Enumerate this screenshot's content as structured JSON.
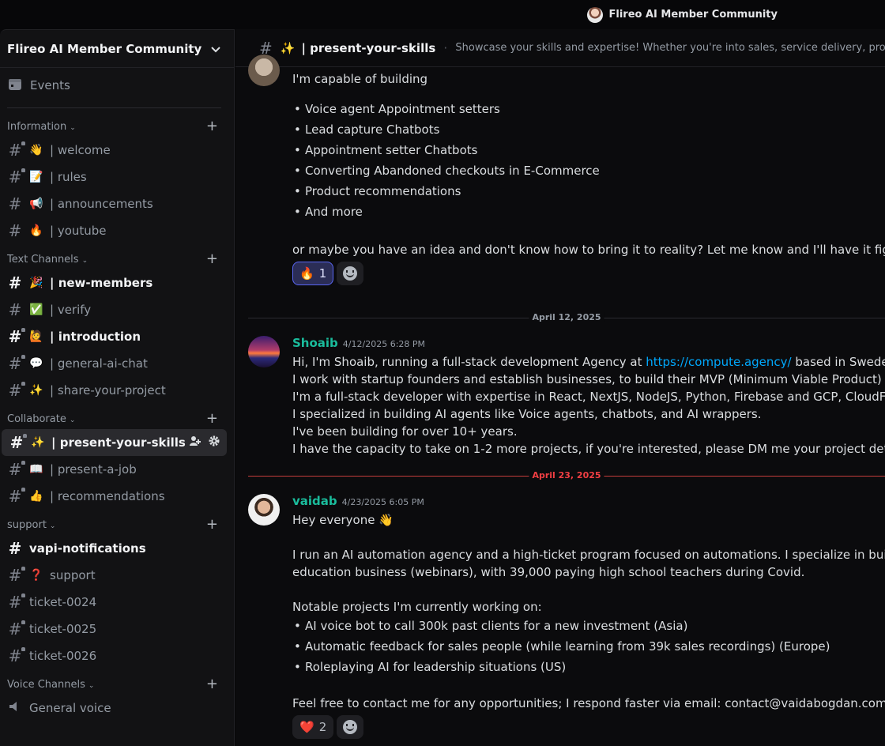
{
  "topbar": {
    "server_title": "Flireo AI Member Community"
  },
  "sidebar": {
    "server_name": "Flireo AI Member Community",
    "events_label": "Events",
    "categories": [
      {
        "name": "Information",
        "channels": [
          {
            "emoji": "👋",
            "label": "| welcome"
          },
          {
            "emoji": "📝",
            "label": "| rules"
          },
          {
            "emoji": "📢",
            "label": "| announcements"
          },
          {
            "emoji": "🔥",
            "label": "| youtube"
          }
        ]
      },
      {
        "name": "Text Channels",
        "channels": [
          {
            "emoji": "🎉",
            "label": "| new-members"
          },
          {
            "emoji": "✅",
            "label": "| verify"
          },
          {
            "emoji": "🙋",
            "label": "| introduction"
          },
          {
            "emoji": "💬",
            "label": "| general-ai-chat"
          },
          {
            "emoji": "✨",
            "label": "| share-your-project"
          }
        ]
      },
      {
        "name": "Collaborate",
        "channels": [
          {
            "emoji": "✨",
            "label": "| present-your-skills"
          },
          {
            "emoji": "📖",
            "label": "| present-a-job"
          },
          {
            "emoji": "👍",
            "label": "| recommendations"
          }
        ]
      },
      {
        "name": "support",
        "channels": [
          {
            "emoji": "",
            "label": "vapi-notifications"
          },
          {
            "emoji": "❓",
            "label": "support"
          },
          {
            "emoji": "",
            "label": "ticket-0024"
          },
          {
            "emoji": "",
            "label": "ticket-0025"
          },
          {
            "emoji": "",
            "label": "ticket-0026"
          }
        ]
      },
      {
        "name": "Voice Channels",
        "channels": [
          {
            "emoji": "",
            "label": "General voice"
          }
        ]
      }
    ]
  },
  "channel_header": {
    "emoji": "✨",
    "title": "| present-your-skills",
    "topic": "Showcase your skills and expertise! Whether you're into sales, service delivery, programming, or"
  },
  "messages": {
    "first": {
      "intro": "I'm capable of building",
      "bullets": [
        "Voice agent Appointment setters",
        "Lead capture Chatbots",
        "Appointment setter Chatbots",
        "Converting Abandoned checkouts in E-Commerce",
        "Product recommendations",
        "And more"
      ],
      "outro": "or maybe you have an idea and don't know how to bring it to reality? Let me know and I'll have it figured out and",
      "reaction_emoji": "🔥",
      "reaction_count": "1"
    },
    "date1": "April 12, 2025",
    "shoaib": {
      "username": "Shoaib",
      "timestamp": "4/12/2025 6:28 PM",
      "line1_pre": "Hi, I'm Shoaib, running a full-stack development Agency at ",
      "line1_link": "https://compute.agency/",
      "line1_post": " based in Sweden.",
      "line2": "I work with startup founders and establish businesses, to build their MVP (Minimum Viable Product) or scale th",
      "line3": "I'm a full-stack developer with expertise in React, NextJS, NodeJS, Python, Firebase and GCP, CloudFlare, Dock",
      "line4": "I specialized in building AI agents like Voice agents, chatbots, and AI wrappers.",
      "line5": "I've been building for over 10+ years.",
      "line6": "I have the capacity to take on 1-2 more projects, if you're interested, please DM me your project details."
    },
    "date2": "April 23, 2025",
    "vaidab": {
      "username": "vaidab",
      "timestamp": "4/23/2025 6:05 PM",
      "greeting": "Hey everyone 👋",
      "para1a": "I run an AI automation agency and a high-ticket program focused on automations. I specialize in building with M",
      "para1b": "education business (webinars), with 39,000 paying high school teachers during Covid.",
      "projects_intro": "Notable projects I'm currently working on:",
      "bullets": [
        "AI voice bot to call 300k past clients for a new investment (Asia)",
        "Automatic feedback for sales people (while learning from 39k sales recordings)  (Europe)",
        "Roleplaying AI for leadership situations (US)"
      ],
      "contact": "Feel free to contact me for any opportunities; I respond faster via email: contact@vaidabogdan.com",
      "reaction_emoji": "❤️",
      "reaction_count": "2"
    }
  }
}
